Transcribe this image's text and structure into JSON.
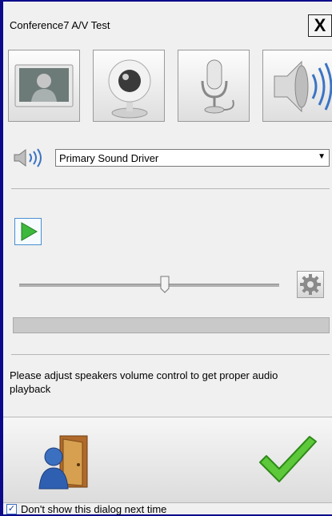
{
  "window": {
    "title": "Conference7 A/V Test",
    "close_label": "X"
  },
  "tabs": [
    {
      "name": "display",
      "icon": "person-monitor-icon"
    },
    {
      "name": "camera",
      "icon": "webcam-icon"
    },
    {
      "name": "microphone",
      "icon": "microphone-icon"
    },
    {
      "name": "speakers",
      "icon": "speaker-icon"
    }
  ],
  "device": {
    "icon": "speaker-icon",
    "selected": "Primary Sound Driver"
  },
  "playback": {
    "play_icon": "play-icon",
    "volume_fraction": 0.56,
    "settings_icon": "gear-icon",
    "level_fraction": 0
  },
  "message": "Please adjust speakers volume control to get proper audio playback",
  "actions": {
    "exit_icon": "exit-door-icon",
    "ok_icon": "green-checkmark-icon"
  },
  "footer": {
    "dont_show_label": "Don't show this dialog next time",
    "dont_show_checked": true
  },
  "colors": {
    "frame": "#0a0a8a",
    "accent_green": "#4fbf2f"
  }
}
